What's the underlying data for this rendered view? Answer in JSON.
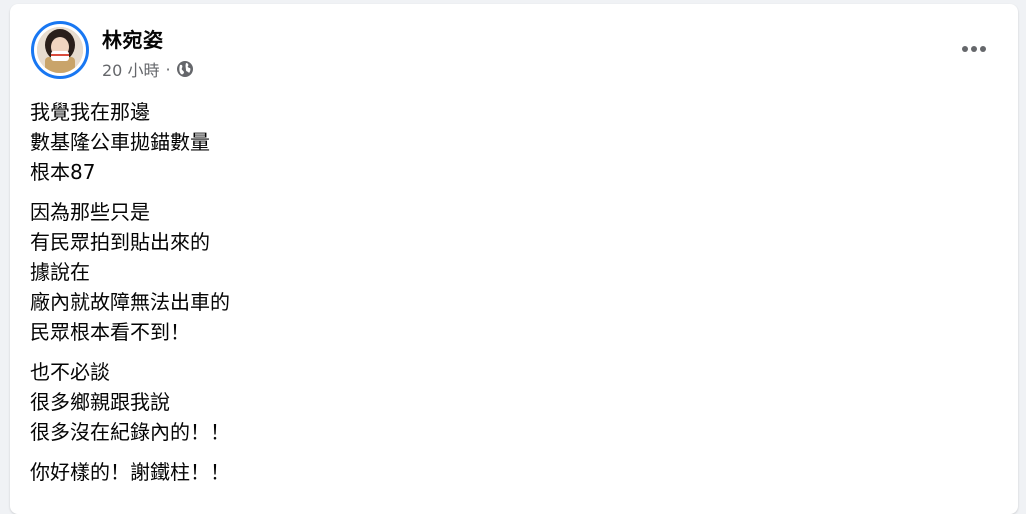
{
  "post": {
    "author": "林宛姿",
    "timestamp": "20 小時",
    "separator": "·",
    "privacy_icon": "globe-icon",
    "more_icon": "more-options-icon",
    "accent_color": "#1877f2",
    "paragraphs": [
      [
        "我覺我在那邊",
        "數基隆公車拋錨數量",
        "根本87"
      ],
      [
        "因為那些只是",
        "有民眾拍到貼出來的",
        "據說在",
        "廠內就故障無法出車的",
        "民眾根本看不到！"
      ],
      [
        "也不必談",
        "很多鄉親跟我說",
        "很多沒在紀錄內的！！"
      ],
      [
        "你好樣的！謝鐵柱！！"
      ]
    ]
  }
}
